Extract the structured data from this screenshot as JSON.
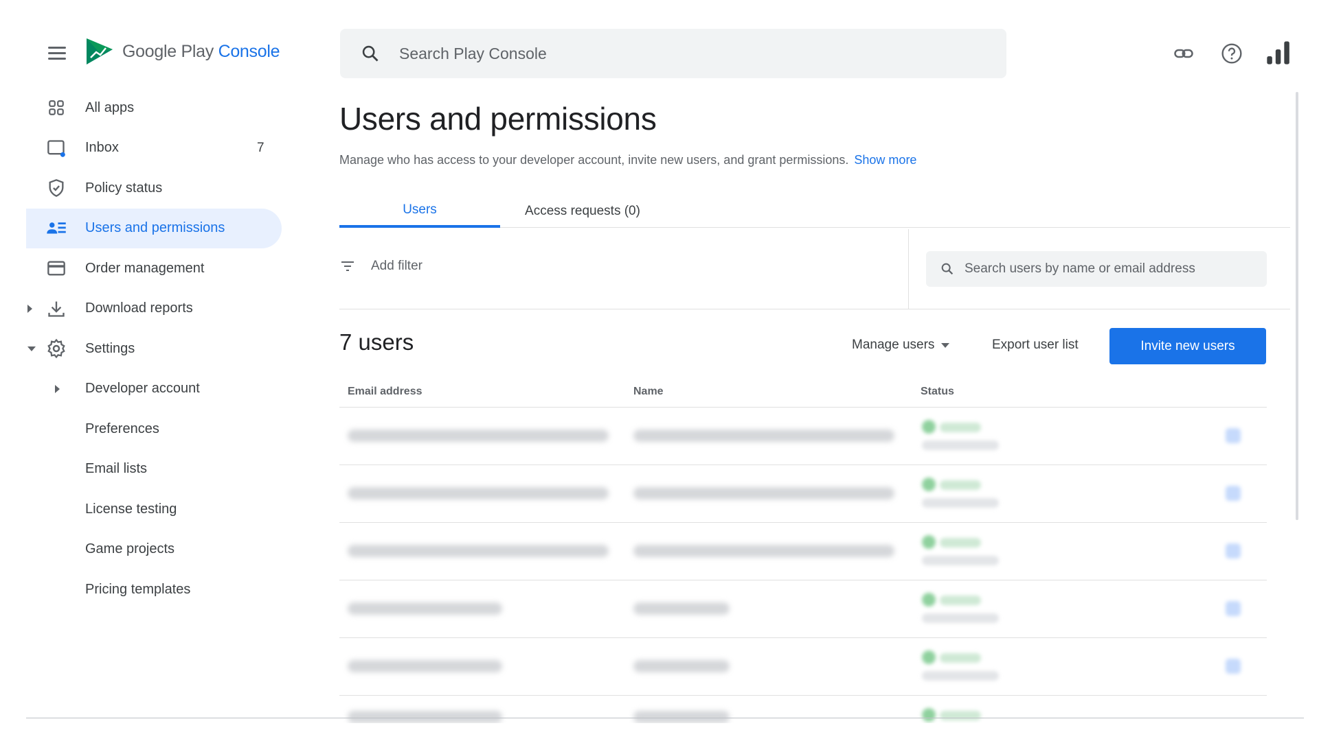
{
  "header": {
    "menu_icon": "hamburger-menu-icon",
    "logo_icon": "google-play-console-logo-icon",
    "brand_name": "Google Play",
    "brand_accent": "Console",
    "search_placeholder": "Search Play Console",
    "icons": [
      "link-icon",
      "help-icon",
      "bar-chart-icon"
    ]
  },
  "sidebar": {
    "items": [
      {
        "label": "All apps",
        "icon": "grid-icon"
      },
      {
        "label": "Inbox",
        "icon": "inbox-icon",
        "count": "7"
      },
      {
        "label": "Policy status",
        "icon": "shield-icon"
      },
      {
        "label": "Users and permissions",
        "icon": "users-icon",
        "active": true
      },
      {
        "label": "Order management",
        "icon": "credit-card-icon"
      },
      {
        "label": "Download reports",
        "icon": "download-icon",
        "expandable": "collapsed"
      },
      {
        "label": "Settings",
        "icon": "gear-icon",
        "expandable": "expanded"
      },
      {
        "label": "Developer account",
        "expandable": "collapsed"
      },
      {
        "label": "Preferences"
      },
      {
        "label": "Email lists"
      },
      {
        "label": "License testing"
      },
      {
        "label": "Game projects"
      },
      {
        "label": "Pricing templates"
      }
    ]
  },
  "main": {
    "title": "Users and permissions",
    "description": "Manage who has access to your developer account, invite new users, and grant permissions.",
    "show_more": "Show more",
    "tabs": [
      {
        "label": "Users",
        "active": true
      },
      {
        "label": "Access requests (0)"
      }
    ],
    "add_filter": "Add filter",
    "user_search_placeholder": "Search users by name or email address",
    "users_count": "7 users",
    "manage_users": "Manage users",
    "export_user_list": "Export user list",
    "invite_button": "Invite new users",
    "table": {
      "columns": [
        "Email address",
        "Name",
        "Status"
      ]
    }
  },
  "colors": {
    "accent": "#1a73e8",
    "active_nav_bg": "#e8f0fe",
    "status_active": "#34a853"
  }
}
